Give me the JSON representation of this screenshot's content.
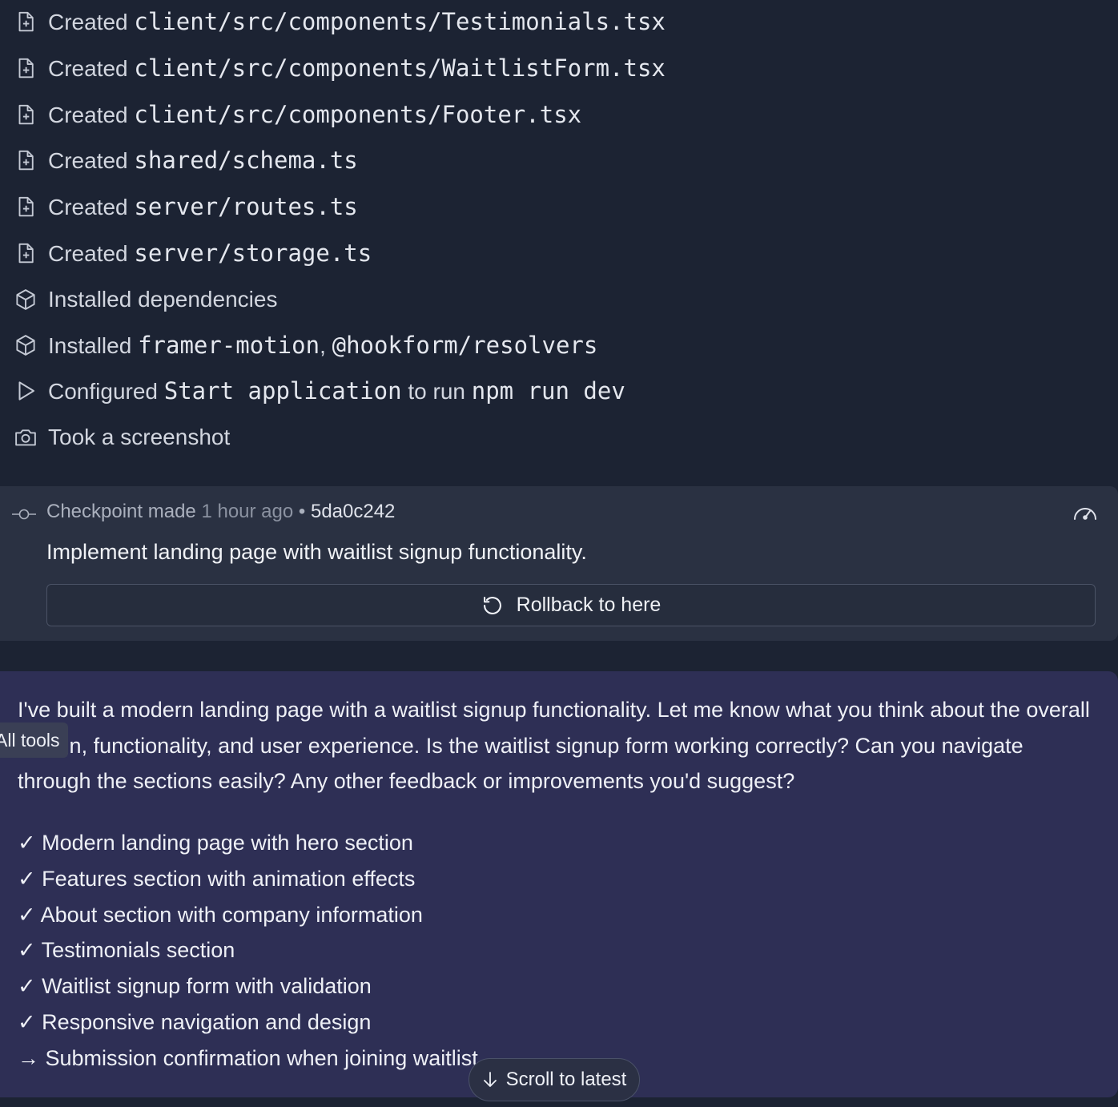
{
  "log": [
    {
      "icon": "file-plus-icon",
      "verb": "Created",
      "path": "client/src/components/Testimonials.tsx"
    },
    {
      "icon": "file-plus-icon",
      "verb": "Created",
      "path": "client/src/components/WaitlistForm.tsx"
    },
    {
      "icon": "file-plus-icon",
      "verb": "Created",
      "path": "client/src/components/Footer.tsx"
    },
    {
      "icon": "file-plus-icon",
      "verb": "Created",
      "path": "shared/schema.ts"
    },
    {
      "icon": "file-plus-icon",
      "verb": "Created",
      "path": "server/routes.ts"
    },
    {
      "icon": "file-plus-icon",
      "verb": "Created",
      "path": "server/storage.ts"
    },
    {
      "icon": "package-icon",
      "text": "Installed dependencies"
    },
    {
      "icon": "package-icon",
      "verb": "Installed",
      "pkg1": "framer-motion",
      "sep": ",",
      "pkg2": "@hookform/resolvers"
    },
    {
      "icon": "play-icon",
      "verb": "Configured",
      "workflow": "Start application",
      "mid": "to run",
      "cmd": "npm run dev"
    },
    {
      "icon": "camera-icon",
      "text": "Took a screenshot"
    }
  ],
  "checkpoint": {
    "label": "Checkpoint made",
    "time": "1 hour ago",
    "dot": "•",
    "hash": "5da0c242",
    "message": "Implement landing page with waitlist signup functionality.",
    "rollback_label": "Rollback to here"
  },
  "agent_message": {
    "paragraph": "I've built a modern landing page with a waitlist signup functionality. Let me know what you think about the overall design, functionality, and user experience. Is the waitlist signup form working correctly? Can you navigate through the sections easily? Any other feedback or improvements you'd suggest?",
    "checklist": [
      "✓ Modern landing page with hero section",
      "✓ Features section with animation effects",
      "✓ About section with company information",
      "✓ Testimonials section",
      "✓ Waitlist signup form with validation",
      "✓ Responsive navigation and design",
      "→ Submission confirmation when joining waitlist"
    ]
  },
  "tools_tab_label": "All tools",
  "scroll_latest_label": "Scroll to latest"
}
